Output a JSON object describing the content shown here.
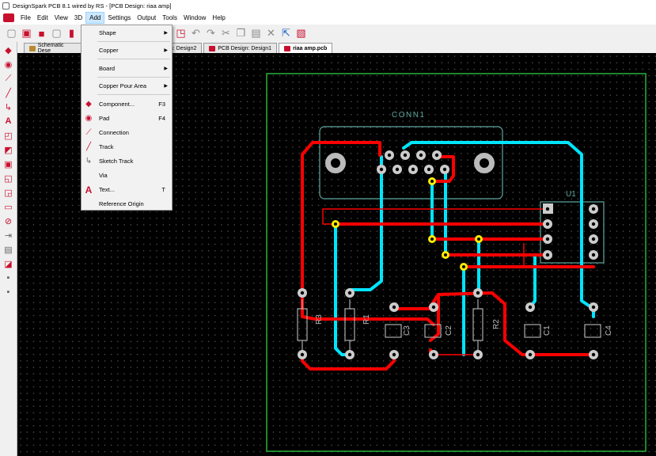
{
  "window": {
    "title": "DesignSpark PCB 8.1 wired by RS - [PCB Design: riaa amp]"
  },
  "menubar": {
    "items": [
      "File",
      "Edit",
      "View",
      "3D",
      "Add",
      "Settings",
      "Output",
      "Tools",
      "Window",
      "Help"
    ],
    "active": "Add"
  },
  "tabs": [
    {
      "label": "Schematic Dese",
      "active": false
    },
    {
      "label": "gn: Design2",
      "active": false
    },
    {
      "label": "PCB Design: Design1",
      "active": false
    },
    {
      "label": "riaa amp.pcb",
      "active": true
    }
  ],
  "add_menu": {
    "items": [
      {
        "label": "Shape",
        "submenu": true
      },
      {
        "label": "Copper",
        "submenu": true
      },
      {
        "label": "Board",
        "submenu": true
      },
      {
        "label": "Copper Pour Area",
        "submenu": true
      },
      {
        "label": "Component...",
        "shortcut": "F3",
        "icon": "component-icon"
      },
      {
        "label": "Pad",
        "shortcut": "F4",
        "icon": "pad-icon"
      },
      {
        "label": "Connection",
        "icon": "connection-icon"
      },
      {
        "label": "Track",
        "icon": "track-icon"
      },
      {
        "label": "Sketch Track",
        "icon": "sketch-track-icon"
      },
      {
        "label": "Via",
        "icon": "via-icon"
      },
      {
        "label": "Text...",
        "shortcut": "T",
        "icon": "text-icon"
      },
      {
        "label": "Reference Origin"
      }
    ]
  },
  "pcb": {
    "labels": {
      "conn": "CONN1",
      "u1": "U1",
      "r3": "R3",
      "r1": "R1",
      "c3": "C3",
      "c2": "C2",
      "r2": "R2",
      "c1": "C1",
      "c4": "C4"
    },
    "colors": {
      "board_outline": "#2ecc40",
      "top_copper": "#ff0000",
      "bottom_copper": "#00e5ff",
      "silkscreen": "#5fa8a0",
      "via": "#ffee00"
    }
  }
}
